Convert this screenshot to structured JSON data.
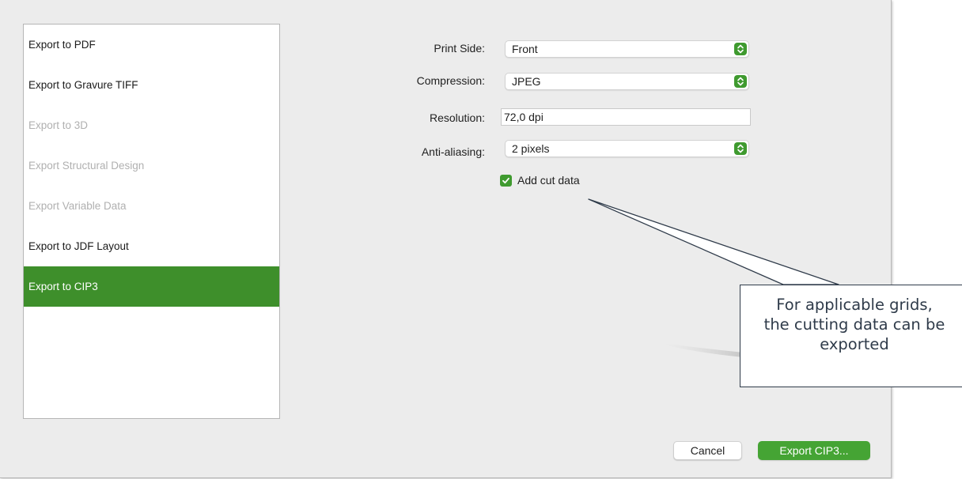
{
  "export_list": {
    "items": [
      {
        "label": "Export to PDF",
        "state": "enabled"
      },
      {
        "label": "Export to Gravure TIFF",
        "state": "enabled"
      },
      {
        "label": "Export to 3D",
        "state": "disabled"
      },
      {
        "label": "Export Structural Design",
        "state": "disabled"
      },
      {
        "label": "Export Variable Data",
        "state": "disabled"
      },
      {
        "label": "Export to JDF Layout",
        "state": "enabled"
      },
      {
        "label": "Export to CIP3",
        "state": "selected"
      }
    ]
  },
  "form": {
    "print_side": {
      "label": "Print Side:",
      "value": "Front"
    },
    "compression": {
      "label": "Compression:",
      "value": "JPEG"
    },
    "resolution": {
      "label": "Resolution:",
      "value": "72,0 dpi"
    },
    "anti_aliasing": {
      "label": "Anti-aliasing:",
      "value": "2 pixels"
    },
    "add_cut_data": {
      "label": "Add cut data",
      "checked": true
    }
  },
  "callout": {
    "line1": "For applicable grids,",
    "line2": "the cutting data can be",
    "line3": "exported"
  },
  "buttons": {
    "cancel": "Cancel",
    "export": "Export CIP3..."
  },
  "icons": {
    "popup_stepper": "up-down-chevron-icon",
    "checkbox": "checkmark-icon"
  },
  "colors": {
    "accent_green": "#3e8f2b",
    "primary_button": "#45a434",
    "callout_border": "#2f3b4a",
    "dialog_background": "#ececec"
  }
}
